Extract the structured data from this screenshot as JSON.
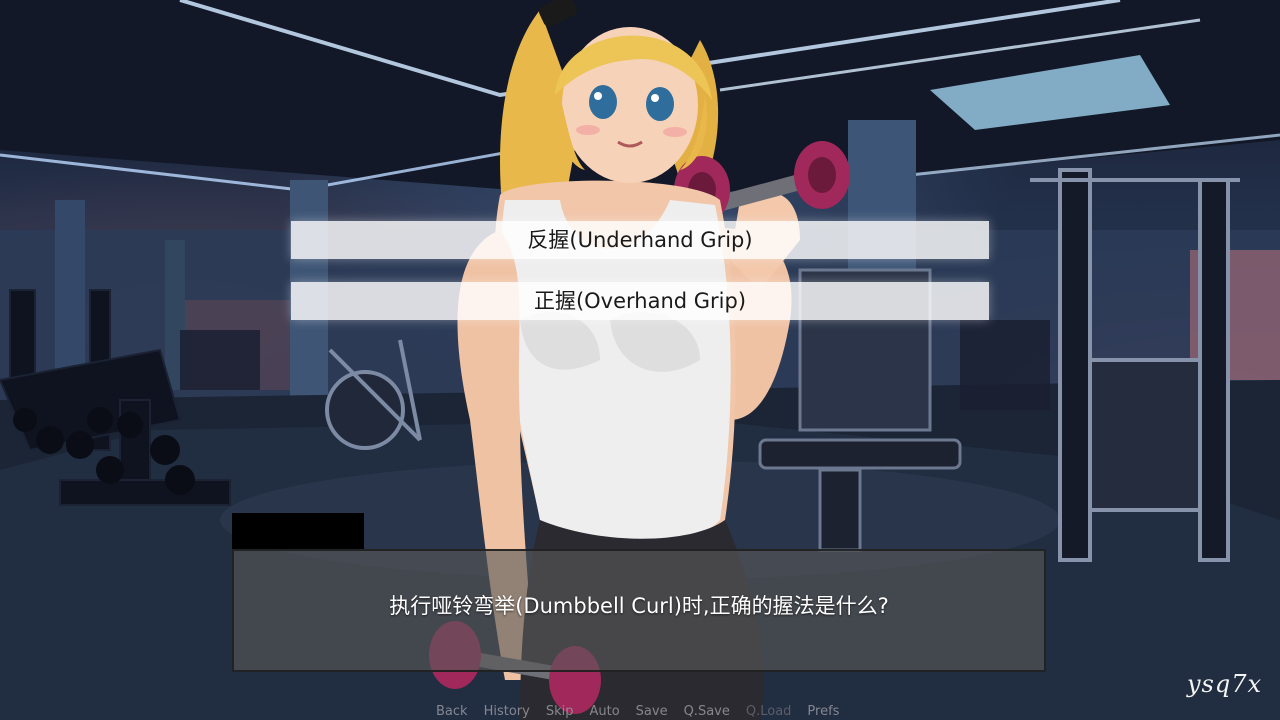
{
  "menu": {
    "choices": [
      {
        "label": "反握(Underhand Grip)"
      },
      {
        "label": "正握(Overhand Grip)"
      }
    ]
  },
  "dialogue": {
    "speaker": "",
    "text": "执行哑铃弯举(Dumbbell Curl)时,正确的握法是什么?"
  },
  "quick_menu": {
    "items": [
      {
        "label": "Back",
        "enabled": true
      },
      {
        "label": "History",
        "enabled": true
      },
      {
        "label": "Skip",
        "enabled": true
      },
      {
        "label": "Auto",
        "enabled": true
      },
      {
        "label": "Save",
        "enabled": true
      },
      {
        "label": "Q.Save",
        "enabled": true
      },
      {
        "label": "Q.Load",
        "enabled": false
      },
      {
        "label": "Prefs",
        "enabled": true
      }
    ]
  },
  "watermark": "ysq7x",
  "colors": {
    "choice_bg": "#ffffffd1",
    "textbox_bg": "#5858589e",
    "namebox_bg": "#000000",
    "dialogue_text": "#ffffff"
  }
}
